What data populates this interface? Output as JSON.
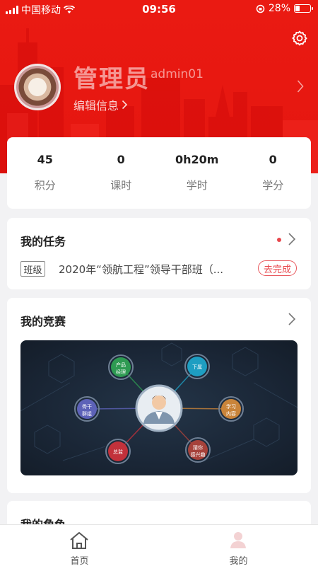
{
  "status_bar": {
    "carrier": "中国移动",
    "time": "09:56",
    "battery_percent": "28%",
    "battery_level": 0.28
  },
  "profile": {
    "name": "管理员",
    "account": "admin01",
    "edit_label": "编辑信息"
  },
  "stats": [
    {
      "value": "45",
      "label": "积分"
    },
    {
      "value": "0",
      "label": "课时"
    },
    {
      "value": "0h20m",
      "label": "学时"
    },
    {
      "value": "0",
      "label": "学分"
    }
  ],
  "tasks": {
    "title": "我的任务",
    "tag": "班级",
    "text": "2020年“领航工程”领导干部班（...",
    "status": "去完成"
  },
  "contest": {
    "title": "我的竞赛",
    "nodes": [
      {
        "label": "产品经理",
        "line1": "产品",
        "line2": "经理",
        "color": "#2e9a52"
      },
      {
        "label": "下属",
        "line1": "下属",
        "line2": "",
        "color": "#1e9ec2"
      },
      {
        "label": "骨干群组",
        "line1": "骨干",
        "line2": "群组",
        "color": "#5d62b8"
      },
      {
        "label": "学习内容",
        "line1": "学习",
        "line2": "内容",
        "color": "#c9843a"
      },
      {
        "label": "总监",
        "line1": "总监",
        "line2": "",
        "color": "#c2313b"
      },
      {
        "label": "猜你感兴趣",
        "line1": "猜你",
        "line2": "感兴趣",
        "color": "#a6423b"
      }
    ]
  },
  "roles": {
    "title": "我的角色"
  },
  "tabbar": {
    "home_label": "首页",
    "mine_label": "我的"
  },
  "colors": {
    "brand_red": "#e51610",
    "accent_red": "#e8474c"
  }
}
